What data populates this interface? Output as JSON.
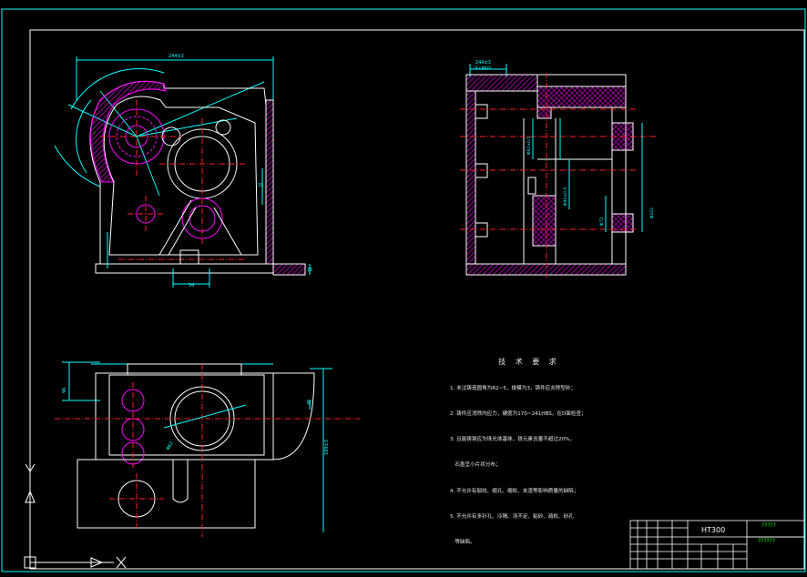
{
  "colors": {
    "background": "#000000",
    "outline": "#ffffff",
    "hatch": "#ff00ff",
    "center_line": "#ff2020",
    "dimension": "#00ffff",
    "hidden_line": "#ffff00",
    "title_block": "#00ff00"
  },
  "technical_requirements": {
    "title": "技 术 要 求",
    "items": [
      "1. 未注铸造圆角为R2~5，拔模为3，铸件应去除型砂；",
      "2. 铸件应消除内应力，硬度为170~241HBS，在D面检查；",
      "3. 且能铸钢应为珠光体基体，铁元素含量不超过20%，",
      "   石墨呈小片状分布；",
      "4. 不允许有裂纹、缩孔、缩松、夹渣等影响质量的缺陷；",
      "5. 不允许有多针孔、冷隔、浇不足、粘砂、疏松、砂孔",
      "   等缺陷。"
    ]
  },
  "title_block": {
    "material": "HT300",
    "drawing_name": "?????",
    "drawing_code": "??????"
  },
  "dimensions": {
    "front_top": "244±2",
    "front_bottom": "34",
    "front_right_width": "33",
    "front_right_base": "15",
    "side_top": "244±3",
    "side_top2": "(4×Φ40)",
    "side_dia1": "Φ62±0.5",
    "side_dia2": "Φ90±0.5",
    "side_dia3": "Φ102",
    "side_bottom_dia": "Φ72",
    "top_left_height": "96",
    "top_right": "35",
    "top_diameter": "Φ62",
    "top_bottom_height": "189±3"
  },
  "axes": {
    "y_label": "Y",
    "x_label": "X"
  }
}
